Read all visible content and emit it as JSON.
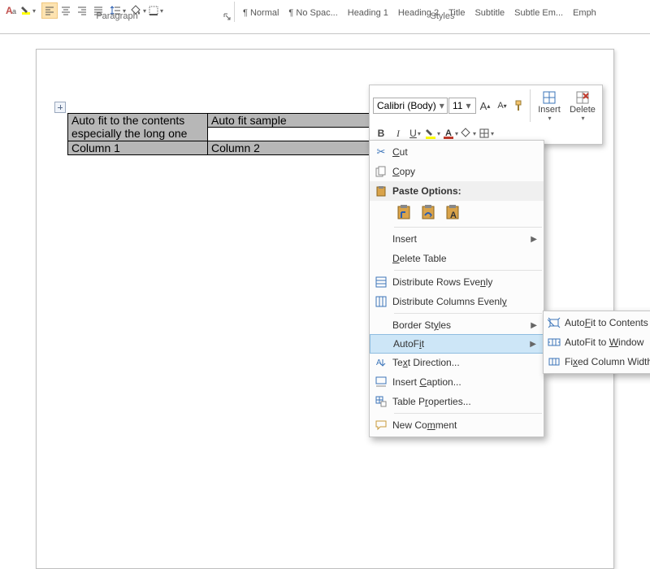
{
  "ribbon": {
    "paragraph_label": "Paragraph",
    "styles_label": "Styles",
    "styles": [
      "¶ Normal",
      "¶ No Spac...",
      "Heading 1",
      "Heading 2",
      "Title",
      "Subtitle",
      "Subtle Em...",
      "Emph"
    ]
  },
  "table": {
    "r1c1_a": "Auto fit to the contents",
    "r1c1_b": "especially the long one",
    "r1c2": "Auto fit sample",
    "r2c1": "Column 1",
    "r2c2": "Column 2"
  },
  "mini_toolbar": {
    "font": "Calibri (Body)",
    "size": "11",
    "insert": "Insert",
    "delete": "Delete"
  },
  "context_menu": {
    "cut": "Cut",
    "copy": "Copy",
    "paste_options": "Paste Options:",
    "insert": "Insert",
    "delete_table": "Delete Table",
    "dist_rows": "Distribute Rows Evenly",
    "dist_cols": "Distribute Columns Evenly",
    "border_styles": "Border Styles",
    "autofit": "AutoFit",
    "text_direction": "Text Direction...",
    "insert_caption": "Insert Caption...",
    "table_properties": "Table Properties...",
    "new_comment": "New Comment"
  },
  "autofit_submenu": {
    "contents": "AutoFit to Contents",
    "window": "AutoFit to Window",
    "fixed": "Fixed Column Width"
  }
}
